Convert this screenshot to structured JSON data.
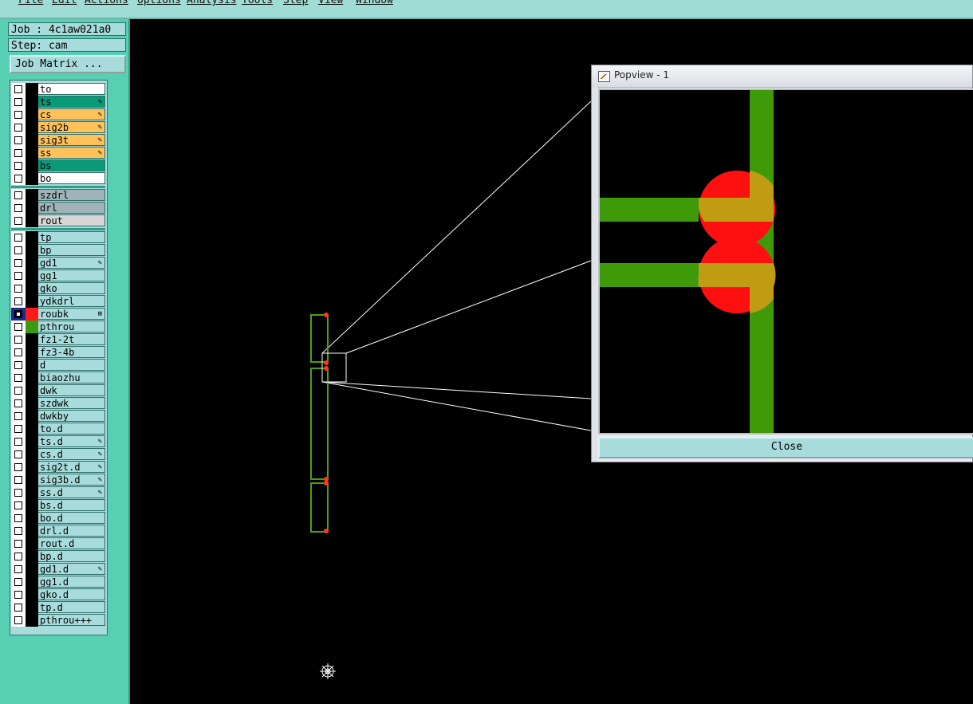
{
  "menubar": {
    "items": [
      "File",
      "Edit",
      "Actions",
      "Options",
      "Analysis",
      "Tools",
      "Step",
      "View",
      "Window"
    ]
  },
  "job": {
    "job_label": "Job : 4c1aw021a0",
    "step_label": "Step: cam",
    "matrix_button": "Job Matrix ..."
  },
  "layers": {
    "group1": [
      {
        "name": "to",
        "color": "#ffffff"
      },
      {
        "name": "ts",
        "color": "#0a9a78",
        "mark": "✎"
      },
      {
        "name": "cs",
        "color": "#ffc25a",
        "mark": "✎"
      },
      {
        "name": "sig2b",
        "color": "#ffc25a",
        "mark": "✎"
      },
      {
        "name": "sig3t",
        "color": "#ffc25a",
        "mark": "✎"
      },
      {
        "name": "ss",
        "color": "#ffc25a",
        "mark": "✎"
      },
      {
        "name": "bs",
        "color": "#0a9a78"
      },
      {
        "name": "bo",
        "color": "#ffffff"
      }
    ],
    "group2": [
      {
        "name": "szdrl",
        "color": "#9fb3b8"
      },
      {
        "name": "drl",
        "color": "#9fb3b8"
      },
      {
        "name": "rout",
        "color": "#d6d6d6"
      }
    ],
    "group3": [
      {
        "name": "tp",
        "color": "#a8dcdc"
      },
      {
        "name": "bp",
        "color": "#a8dcdc"
      },
      {
        "name": "gd1",
        "color": "#a8dcdc",
        "mark": "✎"
      },
      {
        "name": "gg1",
        "color": "#a8dcdc"
      },
      {
        "name": "gko",
        "color": "#a8dcdc"
      },
      {
        "name": "ydkdrl",
        "color": "#a8dcdc"
      },
      {
        "name": "roubk",
        "color": "#a8dcdc",
        "checked": true,
        "swatch": "#ff1a1a",
        "mark": "⊞"
      },
      {
        "name": "pthrou",
        "color": "#a8dcdc",
        "swatch": "#3a9a10"
      },
      {
        "name": "fz1-2t",
        "color": "#a8dcdc"
      },
      {
        "name": "fz3-4b",
        "color": "#a8dcdc"
      },
      {
        "name": "d",
        "color": "#a8dcdc"
      },
      {
        "name": "biaozhu",
        "color": "#a8dcdc"
      },
      {
        "name": "dwk",
        "color": "#a8dcdc"
      },
      {
        "name": "szdwk",
        "color": "#a8dcdc"
      },
      {
        "name": "dwkby",
        "color": "#a8dcdc"
      },
      {
        "name": "to.d",
        "color": "#a8dcdc"
      },
      {
        "name": "ts.d",
        "color": "#a8dcdc",
        "mark": "✎"
      },
      {
        "name": "cs.d",
        "color": "#a8dcdc",
        "mark": "✎"
      },
      {
        "name": "sig2t.d",
        "color": "#a8dcdc",
        "mark": "✎"
      },
      {
        "name": "sig3b.d",
        "color": "#a8dcdc",
        "mark": "✎"
      },
      {
        "name": "ss.d",
        "color": "#a8dcdc",
        "mark": "✎"
      },
      {
        "name": "bs.d",
        "color": "#a8dcdc"
      },
      {
        "name": "bo.d",
        "color": "#a8dcdc"
      },
      {
        "name": "drl.d",
        "color": "#a8dcdc"
      },
      {
        "name": "rout.d",
        "color": "#a8dcdc"
      },
      {
        "name": "bp.d",
        "color": "#a8dcdc"
      },
      {
        "name": "gd1.d",
        "color": "#a8dcdc",
        "mark": "✎"
      },
      {
        "name": "gg1.d",
        "color": "#a8dcdc"
      },
      {
        "name": "gko.d",
        "color": "#a8dcdc"
      },
      {
        "name": "tp.d",
        "color": "#a8dcdc"
      },
      {
        "name": "pthrou+++",
        "color": "#a8dcdc"
      }
    ]
  },
  "popview": {
    "title": "Popview - 1",
    "close_label": "Close"
  },
  "colors": {
    "trace": "#3f9a0a",
    "pad": "#ff1010",
    "overlap": "#bf9c12",
    "outline": "#4aa014",
    "zoom_lines": "#ffffff"
  },
  "icons": {
    "cursor": "crosshair-target-icon",
    "edit_mark": "pencil-icon"
  }
}
